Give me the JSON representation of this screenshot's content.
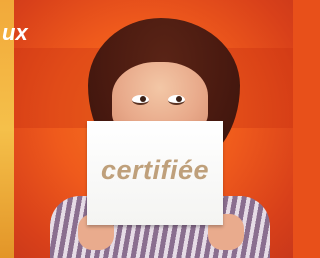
{
  "headline": {
    "text": "ux"
  },
  "card": {
    "text": "certifiée"
  }
}
